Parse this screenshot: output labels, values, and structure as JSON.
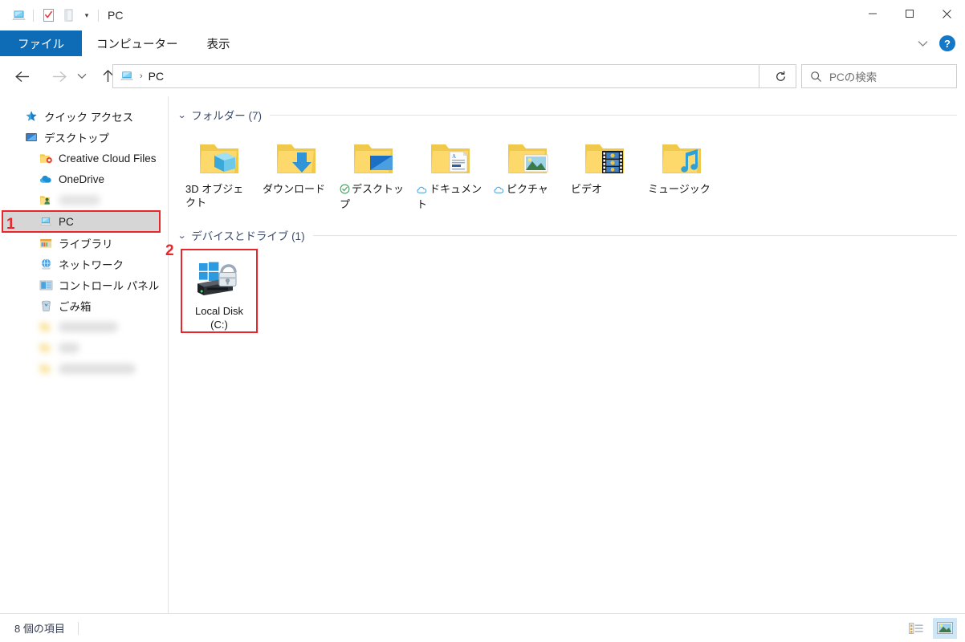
{
  "window": {
    "title": "PC",
    "quick_access_icons": [
      "this-pc-icon",
      "properties-icon",
      "new-folder-icon"
    ],
    "customize_caret": "▾",
    "minimize": "—",
    "maximize": "□",
    "close": "✕"
  },
  "ribbon": {
    "tabs": [
      {
        "label": "ファイル",
        "active": true
      },
      {
        "label": "コンピューター",
        "active": false
      },
      {
        "label": "表示",
        "active": false
      }
    ],
    "collapse_caret": "⌄",
    "help_label": "?"
  },
  "addressbar": {
    "back": "←",
    "forward": "→",
    "recent_caret": "⌄",
    "up": "↑",
    "breadcrumb_icon": "this-pc-icon",
    "breadcrumb_separator": "›",
    "breadcrumb_text": "PC",
    "dropdown_caret": "⌄",
    "refresh": "↻",
    "search_placeholder": "PCの検索"
  },
  "sidebar": {
    "items": [
      {
        "label": "クイック アクセス",
        "icon": "star-icon",
        "level": 0,
        "selected": false,
        "blurred": false
      },
      {
        "label": "デスクトップ",
        "icon": "desktop-icon",
        "level": 0,
        "selected": false,
        "blurred": false
      },
      {
        "label": "Creative Cloud Files",
        "icon": "creative-cloud-folder-icon",
        "level": 1,
        "selected": false,
        "blurred": false
      },
      {
        "label": "OneDrive",
        "icon": "onedrive-cloud-icon",
        "level": 1,
        "selected": false,
        "blurred": false
      },
      {
        "label": "",
        "icon": "user-folder-icon",
        "level": 1,
        "selected": false,
        "blurred": true
      },
      {
        "label": "PC",
        "icon": "this-pc-icon",
        "level": 1,
        "selected": true,
        "blurred": false
      },
      {
        "label": "ライブラリ",
        "icon": "libraries-icon",
        "level": 1,
        "selected": false,
        "blurred": false
      },
      {
        "label": "ネットワーク",
        "icon": "network-icon",
        "level": 1,
        "selected": false,
        "blurred": false
      },
      {
        "label": "コントロール パネル",
        "icon": "control-panel-icon",
        "level": 1,
        "selected": false,
        "blurred": false
      },
      {
        "label": "ごみ箱",
        "icon": "recycle-bin-icon",
        "level": 1,
        "selected": false,
        "blurred": false
      },
      {
        "label": "",
        "icon": "folder-icon",
        "level": 1,
        "selected": false,
        "blurred": true
      },
      {
        "label": "",
        "icon": "folder-icon",
        "level": 1,
        "selected": false,
        "blurred": true
      },
      {
        "label": "",
        "icon": "folder-icon",
        "level": 1,
        "selected": false,
        "blurred": true
      }
    ]
  },
  "content": {
    "groups": [
      {
        "name": "folders-group",
        "chevron": "⌄",
        "label": "フォルダー (7)",
        "items": [
          {
            "label": "3D オブジェクト",
            "icon": "folder-3d-objects-icon",
            "badge": "none"
          },
          {
            "label": "ダウンロード",
            "icon": "folder-downloads-icon",
            "badge": "none"
          },
          {
            "label": "デスクトップ",
            "icon": "folder-desktop-icon",
            "badge": "sync-check-badge"
          },
          {
            "label": "ドキュメント",
            "icon": "folder-documents-icon",
            "badge": "cloud-badge"
          },
          {
            "label": "ピクチャ",
            "icon": "folder-pictures-icon",
            "badge": "cloud-badge"
          },
          {
            "label": "ビデオ",
            "icon": "folder-videos-icon",
            "badge": "none"
          },
          {
            "label": "ミュージック",
            "icon": "folder-music-icon",
            "badge": "none"
          }
        ]
      },
      {
        "name": "devices-group",
        "chevron": "⌄",
        "label": "デバイスとドライブ (1)",
        "items": [
          {
            "label": "Local Disk (C:)",
            "icon": "local-disk-bitlocker-icon",
            "badge": "none",
            "marked": true
          }
        ]
      }
    ]
  },
  "statusbar": {
    "item_count": "8 個の項目",
    "view_details": "details-view-icon",
    "view_large_icons": "large-icons-view-icon"
  },
  "annotations": [
    {
      "number": "1",
      "target": "sidebar-item-pc"
    },
    {
      "number": "2",
      "target": "local-disk-tile"
    }
  ],
  "colors": {
    "accent_blue": "#0d6cb5",
    "annotation_red": "#e8262b",
    "selection_grey": "#d6d6d6",
    "group_header": "#3b4a6b"
  }
}
